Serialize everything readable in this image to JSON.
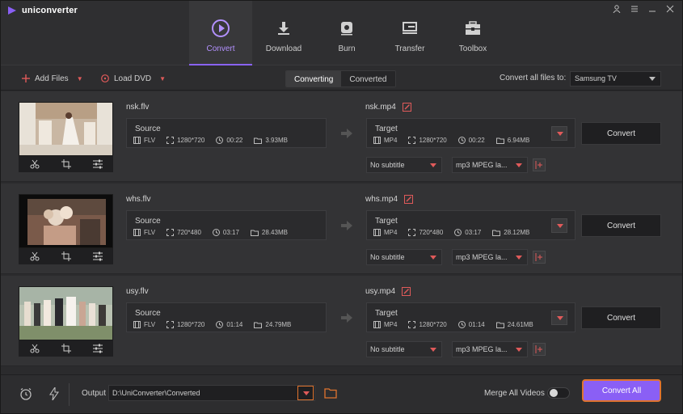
{
  "app": {
    "name": "uniconverter"
  },
  "nav": [
    {
      "label": "Convert",
      "icon": "convert-icon",
      "active": true
    },
    {
      "label": "Download",
      "icon": "download-icon",
      "active": false
    },
    {
      "label": "Burn",
      "icon": "burn-icon",
      "active": false
    },
    {
      "label": "Transfer",
      "icon": "transfer-icon",
      "active": false
    },
    {
      "label": "Toolbox",
      "icon": "toolbox-icon",
      "active": false
    }
  ],
  "toolbar": {
    "add_files": "Add Files",
    "load_dvd": "Load DVD",
    "tab_converting": "Converting",
    "tab_converted": "Converted",
    "convert_all_label": "Convert all files to:",
    "convert_all_value": "Samsung TV"
  },
  "files": [
    {
      "name": "nsk.flv",
      "source": {
        "title": "Source",
        "format": "FLV",
        "resolution": "1280*720",
        "duration": "00:22",
        "size": "3.93MB"
      },
      "target_name": "nsk.mp4",
      "target": {
        "title": "Target",
        "format": "MP4",
        "resolution": "1280*720",
        "duration": "00:22",
        "size": "6.94MB"
      },
      "subtitle": "No subtitle",
      "audio": "mp3 MPEG la...",
      "convert_label": "Convert"
    },
    {
      "name": "whs.flv",
      "source": {
        "title": "Source",
        "format": "FLV",
        "resolution": "720*480",
        "duration": "03:17",
        "size": "28.43MB"
      },
      "target_name": "whs.mp4",
      "target": {
        "title": "Target",
        "format": "MP4",
        "resolution": "720*480",
        "duration": "03:17",
        "size": "28.12MB"
      },
      "subtitle": "No subtitle",
      "audio": "mp3 MPEG la...",
      "convert_label": "Convert"
    },
    {
      "name": "usy.flv",
      "source": {
        "title": "Source",
        "format": "FLV",
        "resolution": "1280*720",
        "duration": "01:14",
        "size": "24.79MB"
      },
      "target_name": "usy.mp4",
      "target": {
        "title": "Target",
        "format": "MP4",
        "resolution": "1280*720",
        "duration": "01:14",
        "size": "24.61MB"
      },
      "subtitle": "No subtitle",
      "audio": "mp3 MPEG la...",
      "convert_label": "Convert"
    }
  ],
  "bottom": {
    "output_label": "Output",
    "output_path": "D:\\UniConverter\\Converted",
    "merge_label": "Merge All Videos",
    "merge_on": false,
    "convert_all": "Convert All"
  },
  "colors": {
    "accent": "#8a5ff5",
    "highlight": "#e0742f",
    "caret": "#e05a5a",
    "background": "#2b2b2d"
  }
}
